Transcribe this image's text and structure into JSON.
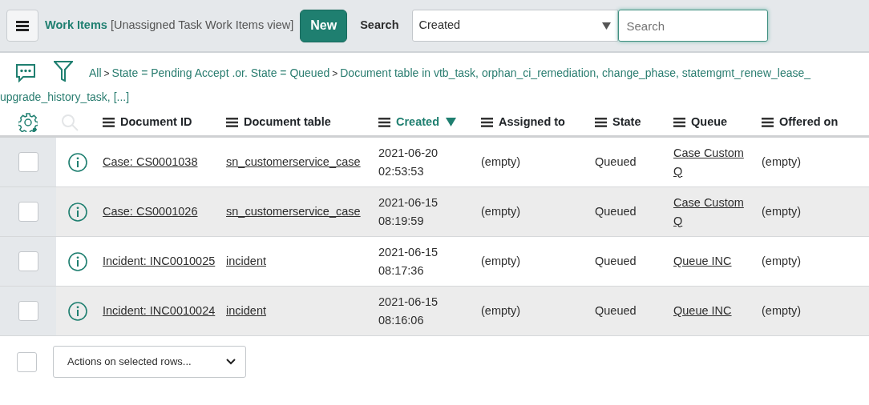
{
  "header": {
    "title": "Work Items",
    "view": "[Unassigned Task Work Items view]",
    "new_button": "New",
    "search_label": "Search",
    "search_field": {
      "value": "Created"
    },
    "search_input": {
      "placeholder": "Search"
    }
  },
  "breadcrumbs": [
    {
      "lines": [
        "All"
      ]
    },
    {
      "separator": ">",
      "lines": [
        "State = Pending Accept .or. State = Queued"
      ]
    },
    {
      "separator": ">",
      "lines": [
        "Document table in vtb_task, orphan_ci_remediation, change_phase, statemgmt_renew_lease_",
        "upgrade_history_task, [...]"
      ]
    }
  ],
  "table": {
    "columns": [
      {
        "label": "Document ID",
        "sorted": false
      },
      {
        "label": "Document table",
        "sorted": false
      },
      {
        "label": "Created",
        "sorted": true
      },
      {
        "label": "Assigned to",
        "sorted": false
      },
      {
        "label": "State",
        "sorted": false
      },
      {
        "label": "Queue",
        "sorted": false
      },
      {
        "label": "Offered on",
        "sorted": false
      }
    ],
    "rows": [
      {
        "checked": false,
        "document_id": "Case: CS0001038",
        "document_table": "sn_customerservice_case",
        "created": "2021-06-20 02:53:53",
        "assigned_to": "(empty)",
        "state": "Queued",
        "queue": "Case Custom Q",
        "offered_on": "(empty)"
      },
      {
        "checked": false,
        "document_id": "Case: CS0001026",
        "document_table": "sn_customerservice_case",
        "created": "2021-06-15 08:19:59",
        "assigned_to": "(empty)",
        "state": "Queued",
        "queue": "Case Custom Q",
        "offered_on": "(empty)"
      },
      {
        "checked": false,
        "document_id": "Incident: INC0010025",
        "document_table": "incident",
        "created": "2021-06-15 08:17:36",
        "assigned_to": "(empty)",
        "state": "Queued",
        "queue": "Queue INC",
        "offered_on": "(empty)"
      },
      {
        "checked": false,
        "document_id": "Incident: INC0010024",
        "document_table": "incident",
        "created": "2021-06-15 08:16:06",
        "assigned_to": "(empty)",
        "state": "Queued",
        "queue": "Queue INC",
        "offered_on": "(empty)"
      }
    ]
  },
  "footer": {
    "select_all_checked": false,
    "actions_select": {
      "value": "Actions on selected rows..."
    }
  }
}
